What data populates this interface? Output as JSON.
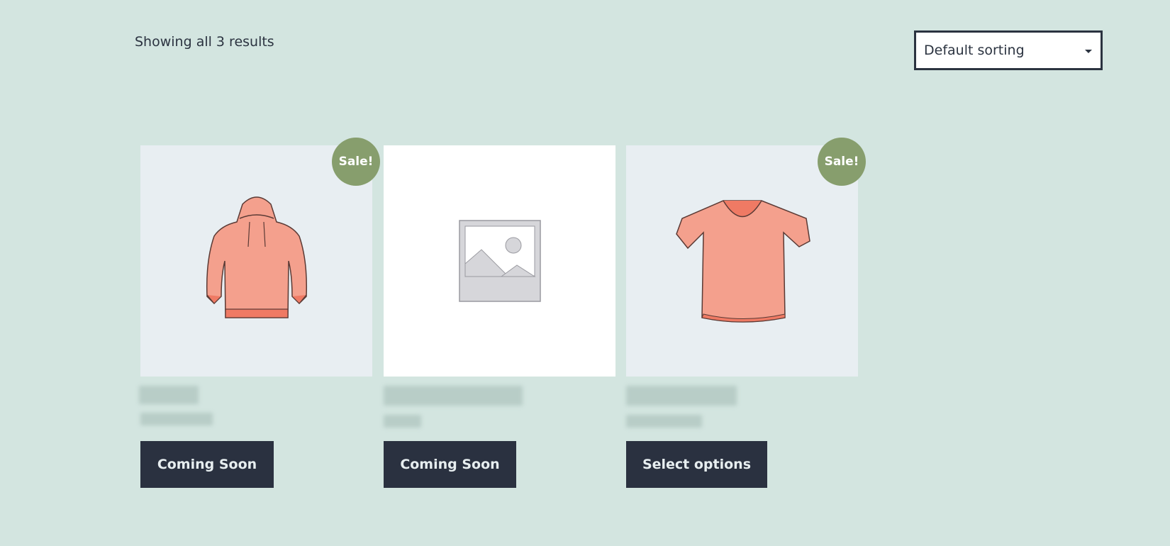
{
  "results": {
    "count_text": "Showing all 3 results"
  },
  "sorting": {
    "selected": "Default sorting"
  },
  "products": [
    {
      "badge": "Sale!",
      "button": "Coming Soon",
      "image": "hoodie"
    },
    {
      "badge": "",
      "button": "Coming Soon",
      "image": "placeholder"
    },
    {
      "badge": "Sale!",
      "button": "Select options",
      "image": "t-shirt"
    }
  ],
  "colors": {
    "background": "#d3e5e0",
    "badge": "#879e6d",
    "button": "#2a3140",
    "product_orange": "#f4a08d"
  }
}
